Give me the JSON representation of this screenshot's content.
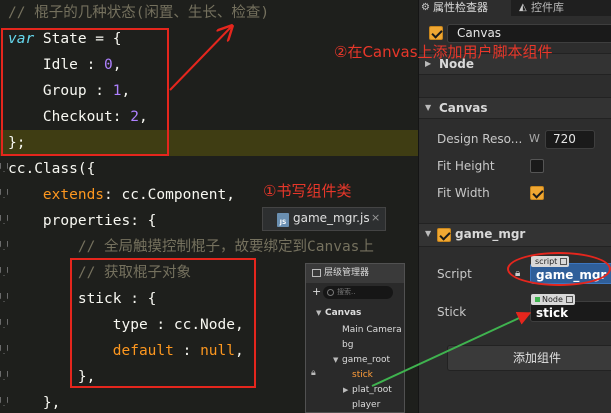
{
  "editor": {
    "lines": [
      {
        "tokens": [
          {
            "c": "cm",
            "t": "// 棍子的几种状态(闲置、生长、检查)"
          }
        ]
      },
      {
        "tokens": [
          {
            "c": "kw",
            "t": "var"
          },
          {
            "c": "txt",
            "t": " State = {"
          }
        ]
      },
      {
        "tokens": [
          {
            "c": "txt",
            "t": "    Idle : "
          },
          {
            "c": "num",
            "t": "0"
          },
          {
            "c": "txt",
            "t": ","
          }
        ]
      },
      {
        "tokens": [
          {
            "c": "txt",
            "t": "    Group : "
          },
          {
            "c": "num",
            "t": "1"
          },
          {
            "c": "txt",
            "t": ","
          }
        ]
      },
      {
        "tokens": [
          {
            "c": "txt",
            "t": "    Checkout: "
          },
          {
            "c": "num",
            "t": "2"
          },
          {
            "c": "txt",
            "t": ","
          }
        ]
      },
      {
        "tokens": [
          {
            "c": "txt",
            "t": "};"
          }
        ]
      },
      {
        "tokens": [
          {
            "c": "txt",
            "t": "cc.Class({"
          }
        ]
      },
      {
        "tokens": [
          {
            "c": "txt",
            "t": "    "
          },
          {
            "c": "org",
            "t": "extends"
          },
          {
            "c": "txt",
            "t": ": cc.Component,"
          }
        ]
      },
      {
        "tokens": [
          {
            "c": "txt",
            "t": "    properties: {"
          }
        ]
      },
      {
        "tokens": [
          {
            "c": "cm",
            "t": "        // 全局触摸控制棍子，故要绑定到Canvas上"
          }
        ]
      },
      {
        "tokens": [
          {
            "c": "cm",
            "t": "        // 获取棍子对象"
          }
        ]
      },
      {
        "tokens": [
          {
            "c": "txt",
            "t": "        stick : {"
          }
        ]
      },
      {
        "tokens": [
          {
            "c": "txt",
            "t": "            type : cc.Node,"
          }
        ]
      },
      {
        "tokens": [
          {
            "c": "txt",
            "t": "            "
          },
          {
            "c": "org",
            "t": "default"
          },
          {
            "c": "txt",
            "t": " : "
          },
          {
            "c": "org",
            "t": "null"
          },
          {
            "c": "txt",
            "t": ","
          }
        ]
      },
      {
        "tokens": [
          {
            "c": "txt",
            "t": "        },"
          }
        ]
      },
      {
        "tokens": [
          {
            "c": "txt",
            "t": "    },"
          }
        ]
      }
    ],
    "tab": {
      "filename": "game_mgr.js",
      "close": "×",
      "icon": "js-file-icon",
      "icon_text": "JS"
    }
  },
  "annotations": {
    "canvas_note": "②在Canvas上添加用户脚本组件",
    "class_note": "①书写组件类"
  },
  "hierarchy": {
    "title": "层级管理器",
    "add": "+",
    "search_placeholder": "搜索..",
    "root": "Canvas",
    "items": [
      "Main Camera",
      "bg",
      "game_root",
      "stick",
      "plat_root",
      "player"
    ],
    "selected": "stick"
  },
  "inspector": {
    "tabs": [
      {
        "label": "属性检查器",
        "icon": "gear-icon",
        "active": true
      },
      {
        "label": "控件库",
        "icon": "widget-icon",
        "active": false
      }
    ],
    "node_name": "Canvas",
    "node_active": true,
    "sections": {
      "node": "Node",
      "canvas": "Canvas"
    },
    "canvas": {
      "design_resolution_label": "Design Reso...",
      "w_label": "W",
      "w_value": "720",
      "fit_height_label": "Fit Height",
      "fit_height": false,
      "fit_width_label": "Fit Width",
      "fit_width": true
    },
    "component": {
      "name": "game_mgr",
      "enabled": true,
      "script_label": "Script",
      "script_badge": "script",
      "script_value": "game_mgr",
      "stick_label": "Stick",
      "stick_badge": "Node",
      "stick_value": "stick"
    },
    "add_component_label": "添加组件"
  },
  "colors": {
    "annotation": "#e5261d",
    "accent": "#f0a732"
  }
}
